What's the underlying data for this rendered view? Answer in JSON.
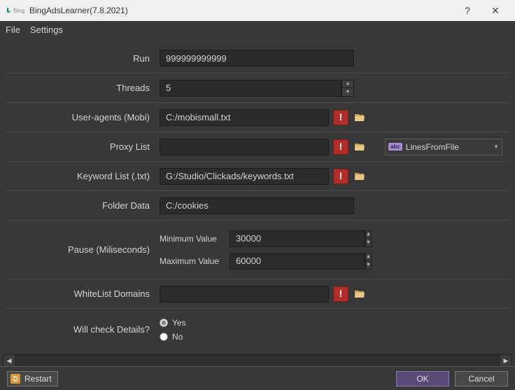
{
  "title": "BingAdsLearner(7.8.2021)",
  "bing_text": "Bing",
  "menu": {
    "file": "File",
    "settings": "Settings"
  },
  "labels": {
    "run": "Run",
    "threads": "Threads",
    "user_agents": "User-agents (Mobi)",
    "proxy_list": "Proxy List",
    "keyword_list": "Keyword List (.txt)",
    "folder_data": "Folder Data",
    "pause": "Pause (Miliseconds)",
    "min": "Minimum Value",
    "max": "Maximum Value",
    "whitelist": "WhiteList Domains",
    "details": "Will check Details?"
  },
  "values": {
    "run": "999999999999",
    "threads": "5",
    "user_agents": "C:/mobismall.txt",
    "proxy_list": "",
    "keyword_list": "G:/Studio/Clickads/keywords.txt",
    "folder_data": "C:/cookies",
    "min": "30000",
    "max": "60000",
    "whitelist": ""
  },
  "proxy_source": {
    "label": "LinesFromFile"
  },
  "radios": {
    "yes": "Yes",
    "no": "No",
    "selected": "yes"
  },
  "buttons": {
    "restart": "Restart",
    "ok": "OK",
    "cancel": "Cancel"
  }
}
